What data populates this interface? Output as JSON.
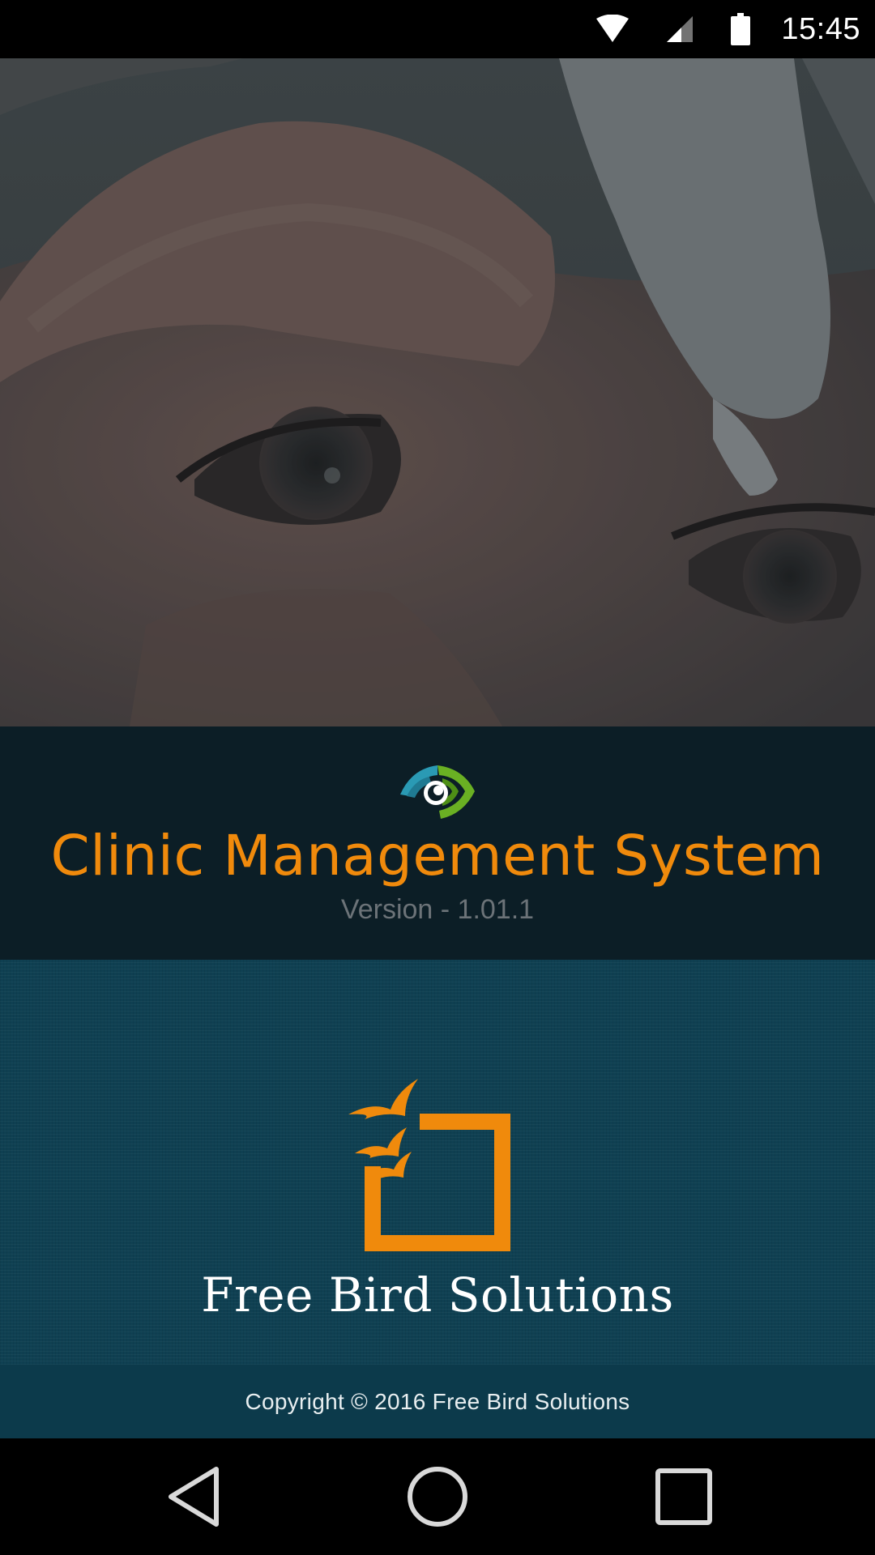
{
  "status_bar": {
    "time": "15:45",
    "icons": [
      "wifi-icon",
      "cell-signal-icon",
      "battery-icon"
    ]
  },
  "hero": {
    "image": "eye-drop-photo"
  },
  "app": {
    "title": "Clinic Management System",
    "version": "Version - 1.01.1",
    "logo_icon": "eye-logo-icon"
  },
  "company": {
    "name": "Free Bird Solutions",
    "logo_icon": "free-bird-logo-icon",
    "copyright": "Copyright © 2016 Free Bird Solutions"
  },
  "nav_bar": {
    "buttons": [
      "back-icon",
      "home-icon",
      "recents-icon"
    ]
  },
  "colors": {
    "accent_orange": "#f08a0c",
    "title_band_bg": "#0c1e26",
    "company_bg": "#0f4052",
    "copyright_bg": "#0c3a4b",
    "logo_teal": "#2a9ab4",
    "logo_green": "#6ab023"
  }
}
